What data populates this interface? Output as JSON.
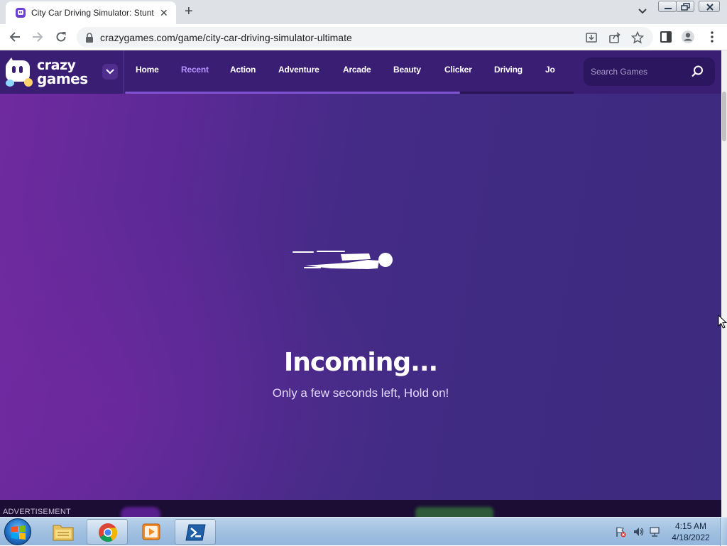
{
  "browser": {
    "tab_title": "City Car Driving Simulator: Stunt",
    "url": "crazygames.com/game/city-car-driving-simulator-ultimate"
  },
  "site": {
    "logo_line1": "crazy",
    "logo_line2": "games",
    "nav": [
      "Home",
      "Recent",
      "Action",
      "Adventure",
      "Arcade",
      "Beauty",
      "Clicker",
      "Driving",
      "Jo"
    ],
    "active_nav": "Recent",
    "search_placeholder": "Search Games",
    "accent_color": "#b693ff",
    "header_color": "#3a1e74"
  },
  "game": {
    "loading_title": "Incoming...",
    "loading_subtitle": "Only a few seconds left, Hold on!"
  },
  "ad": {
    "label": "ADVERTISEMENT"
  },
  "taskbar": {
    "pinned": [
      "windows-explorer",
      "google-chrome",
      "media-player",
      "powershell"
    ],
    "active": "google-chrome",
    "time": "4:15 AM",
    "date": "4/18/2022"
  }
}
